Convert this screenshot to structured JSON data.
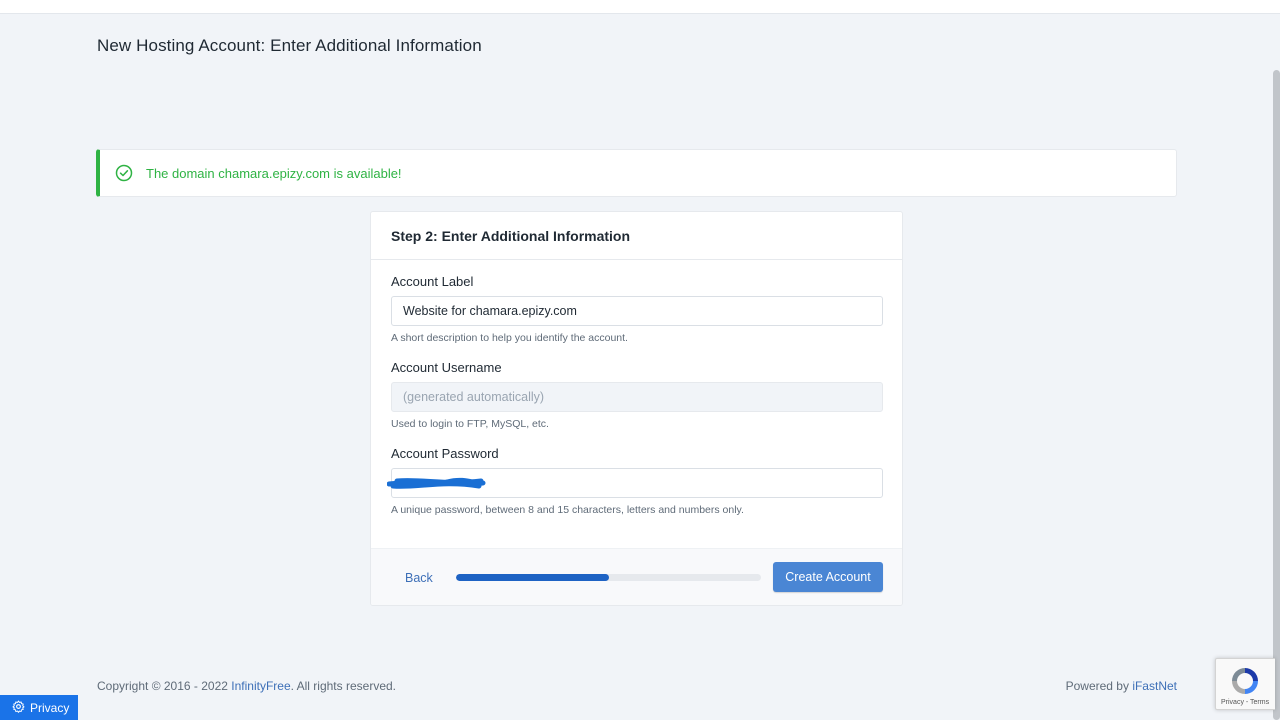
{
  "page": {
    "title": "New Hosting Account: Enter Additional Information"
  },
  "alert": {
    "message": "The domain chamara.epizy.com is available!",
    "icon": "check-circle-icon",
    "color": "#2fb344"
  },
  "form": {
    "step_title": "Step 2: Enter Additional Information",
    "account_label": {
      "label": "Account Label",
      "value": "Website for chamara.epizy.com",
      "hint": "A short description to help you identify the account."
    },
    "account_username": {
      "label": "Account Username",
      "placeholder": "(generated automatically)",
      "hint": "Used to login to FTP, MySQL, etc."
    },
    "account_password": {
      "label": "Account Password",
      "hint": "A unique password, between 8 and 15 characters, letters and numbers only."
    }
  },
  "footer_actions": {
    "back_label": "Back",
    "progress_percent": 50,
    "create_label": "Create Account",
    "accent_color": "#4a86d4"
  },
  "site_footer": {
    "copyright_prefix": "Copyright © 2016 - 2022 ",
    "copyright_link": "InfinityFree",
    "copyright_suffix": ". All rights reserved.",
    "powered_prefix": "Powered by ",
    "powered_link": "iFastNet"
  },
  "privacy": {
    "label": "Privacy",
    "icon": "gear-icon"
  },
  "recaptcha": {
    "terms": "Privacy - Terms",
    "icon": "recaptcha-logo-icon"
  }
}
